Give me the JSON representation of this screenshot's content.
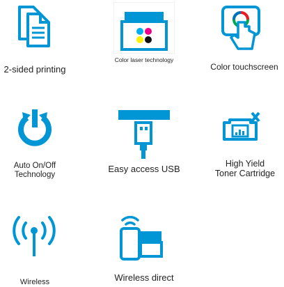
{
  "colors": {
    "icon_blue": "#0096d6",
    "text": "#222222"
  },
  "features": [
    {
      "label": "2-sided printing",
      "icon": "duplex-document-icon"
    },
    {
      "label": "Color laser technology",
      "icon": "color-laser-printer-icon"
    },
    {
      "label": "Color touchscreen",
      "icon": "touchscreen-icon"
    },
    {
      "label_line1": "Auto On/Off",
      "label_line2": "Technology",
      "icon": "power-icon"
    },
    {
      "label": "Easy access USB",
      "icon": "usb-icon"
    },
    {
      "label_line1": "High Yield",
      "label_line2": "Toner Cartridge",
      "icon": "toner-cartridge-icon"
    },
    {
      "label": "Wireless",
      "icon": "wireless-antenna-icon"
    },
    {
      "label": "Wireless direct",
      "icon": "wireless-direct-icon"
    }
  ]
}
